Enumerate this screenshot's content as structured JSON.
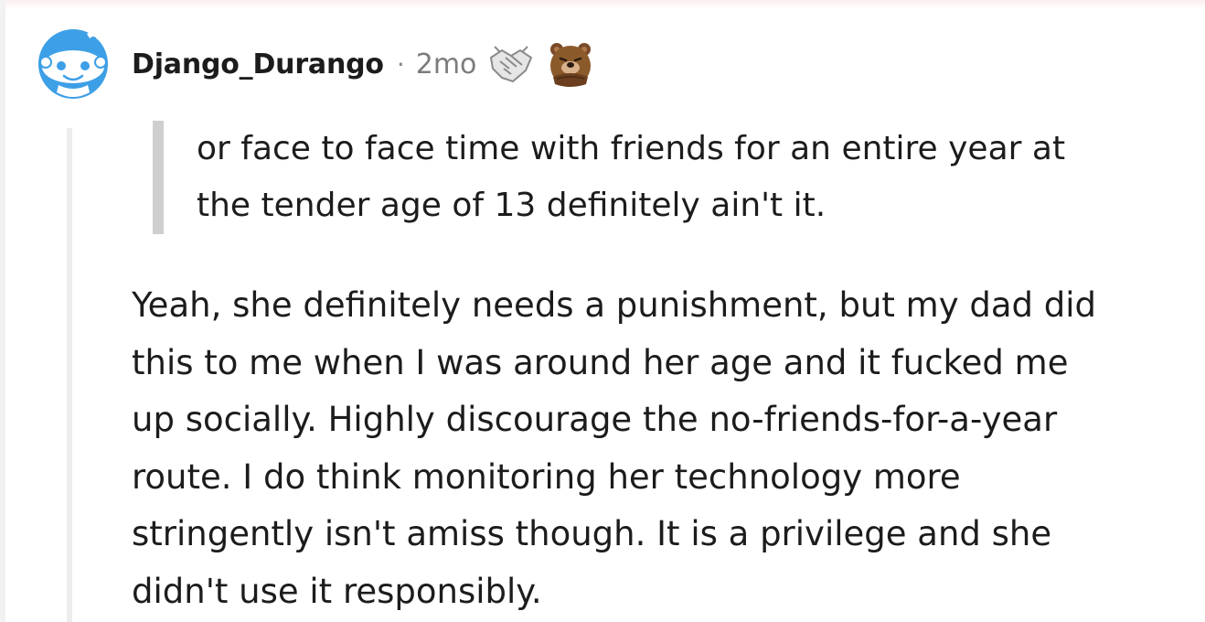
{
  "comment": {
    "username": "Django_Durango",
    "separator": "·",
    "time": "2mo",
    "avatar_icon": "snoo-avatar-icon",
    "awards": [
      "handshake-award-icon",
      "bear-award-icon"
    ],
    "quote_lines": [
      "or face to face time with friends for an entire year at",
      "the tender age of 13 definitely ain't it."
    ],
    "body_lines": [
      "Yeah, she definitely needs a punishment, but my dad did",
      "this to me when I was around her age and it fucked me",
      "up socially. Highly discourage the no-friends-for-a-year",
      "route. I do think monitoring her technology more",
      "stringently isn't amiss though. It is a privilege and she",
      "didn't use it responsibly."
    ]
  },
  "colors": {
    "avatar_blue": "#3d9fe6",
    "quote_bar": "#cfcfcf",
    "thread_line": "#ededed",
    "text": "#1c1c1c",
    "meta": "#7c7c7c"
  }
}
